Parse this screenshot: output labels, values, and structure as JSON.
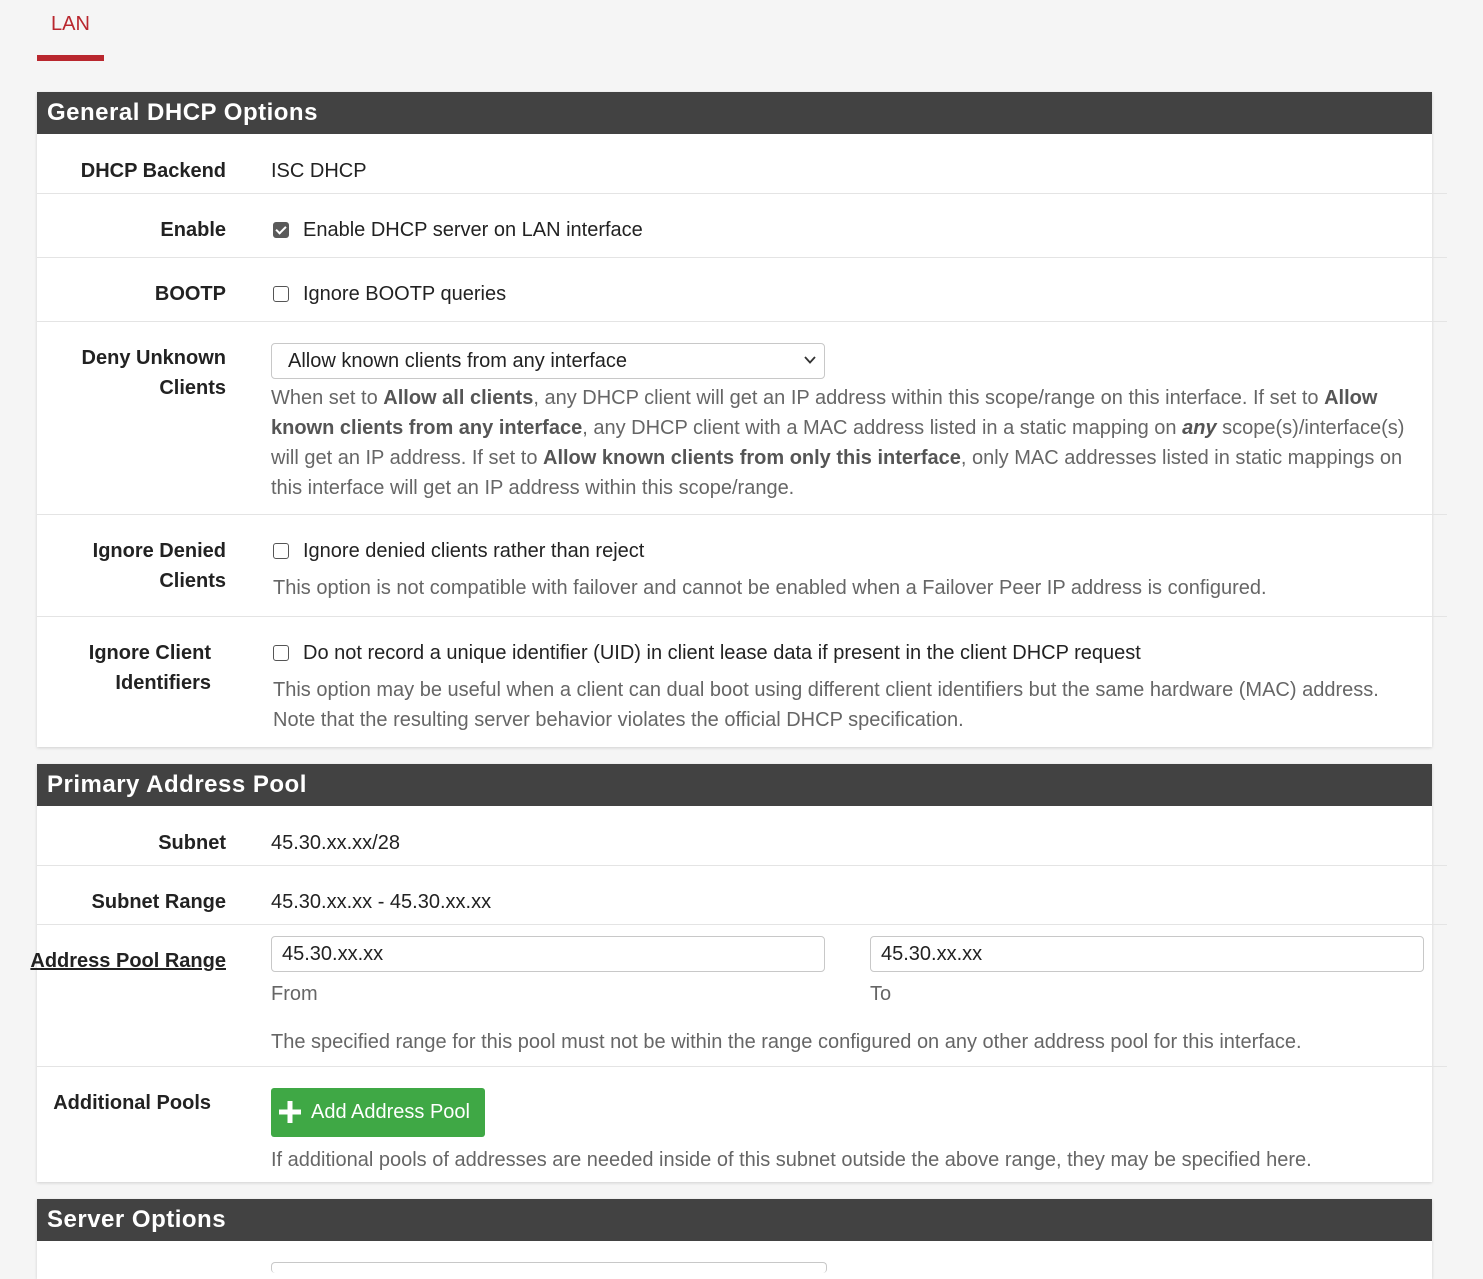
{
  "tabs": {
    "active": "LAN"
  },
  "general": {
    "heading": "General DHCP Options",
    "backend_label": "DHCP Backend",
    "backend_value": "ISC DHCP",
    "enable_label": "Enable",
    "enable_text": "Enable DHCP server on LAN interface",
    "enable_checked": true,
    "bootp_label": "BOOTP",
    "bootp_text": "Ignore BOOTP queries",
    "deny_label_1": "Deny Unknown",
    "deny_label_2": "Clients",
    "deny_selected": "Allow known clients from any interface",
    "deny_help": {
      "p1": "When set to ",
      "b1": "Allow all clients",
      "p2": ", any DHCP client will get an IP address within this scope/range on this interface. If set to ",
      "b2": "Allow known clients from any interface",
      "p3": ", any DHCP client with a MAC address listed in a static mapping on ",
      "b3": "any",
      "p4": " scope(s)/interface(s) will get an IP address. If set to ",
      "b4": "Allow known clients from only this interface",
      "p5": ", only MAC addresses listed in static mappings on this interface will get an IP address within this scope/range."
    },
    "ignore_denied_label_1": "Ignore Denied",
    "ignore_denied_label_2": "Clients",
    "ignore_denied_text": "Ignore denied clients rather than reject",
    "ignore_denied_help": "This option is not compatible with failover and cannot be enabled when a Failover Peer IP address is configured.",
    "ignore_cid_label_1": "Ignore Client",
    "ignore_cid_label_2": "Identifiers",
    "ignore_cid_text": "Do not record a unique identifier (UID) in client lease data if present in the client DHCP request",
    "ignore_cid_help": "This option may be useful when a client can dual boot using different client identifiers but the same hardware (MAC) address. Note that the resulting server behavior violates the official DHCP specification."
  },
  "pool": {
    "heading": "Primary Address Pool",
    "subnet_label": "Subnet",
    "subnet_value": "45.30.xx.xx/28",
    "range_label": "Subnet Range",
    "range_value": "45.30.xx.xx - 45.30.xx.xx",
    "pool_range_label": "Address Pool Range",
    "from_value": "45.30.xx.xx",
    "from_label": "From",
    "to_value": "45.30.xx.xx",
    "to_label": "To",
    "pool_range_help": "The specified range for this pool must not be within the range configured on any other address pool for this interface.",
    "additional_label": "Additional Pools",
    "add_button": "Add Address Pool",
    "additional_help": "If additional pools of addresses are needed inside of this subnet outside the above range, they may be specified here."
  },
  "server": {
    "heading": "Server Options"
  },
  "colors": {
    "accent_red": "#b9272e",
    "heading_bg": "#424242",
    "button_green": "#3fa845"
  }
}
